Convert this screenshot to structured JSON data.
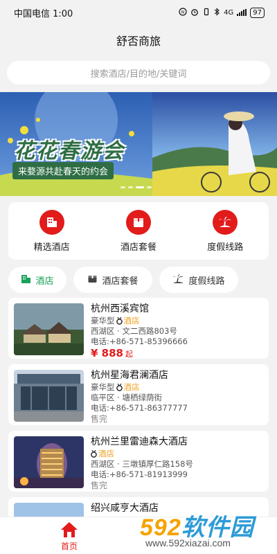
{
  "status": {
    "carrier_time": "中国电信 1:00",
    "battery": "97",
    "network": "4G"
  },
  "app": {
    "title": "舒否商旅"
  },
  "search": {
    "placeholder": "搜索酒店/目的地/关键词"
  },
  "banner": {
    "title": "花花春游会",
    "subtitle": "来婺源共赴春天的约会"
  },
  "categories": [
    {
      "label": "精选酒店",
      "icon": "hotel-building-icon"
    },
    {
      "label": "酒店套餐",
      "icon": "package-box-icon"
    },
    {
      "label": "度假线路",
      "icon": "palm-island-icon"
    }
  ],
  "tabs": [
    {
      "label": "酒店",
      "icon": "hotel-building-icon",
      "active": true
    },
    {
      "label": "酒店套餐",
      "icon": "package-box-icon",
      "active": false
    },
    {
      "label": "度假线路",
      "icon": "palm-island-icon",
      "active": false
    }
  ],
  "hotels": [
    {
      "name": "杭州西溪宾馆",
      "grade": "豪华型",
      "type": "酒店",
      "address": "西湖区 · 文二西路803号",
      "phone": "电话:+86-571-85396666",
      "price": "¥ 888",
      "price_suffix": "起"
    },
    {
      "name": "杭州星海君澜酒店",
      "grade": "豪华型",
      "type": "酒店",
      "address": "临平区 · 塘栖绿荫街",
      "phone": "电话:+86-571-86377777",
      "status": "售完"
    },
    {
      "name": "杭州兰里雷迪森大酒店",
      "grade": "",
      "type": "酒店",
      "address": "西湖区 · 三墩镇厚仁路158号",
      "phone": "电话:+86-571-81913999",
      "status": "售完"
    },
    {
      "name": "绍兴咸亨大酒店"
    }
  ],
  "bottom_nav": {
    "home_label": "首页"
  },
  "watermark": {
    "brand_num": "592",
    "brand_text": "软件园",
    "url": "www.592xiazai.com"
  },
  "colors": {
    "accent_red": "#e21b1b",
    "active_green": "#1aa15a",
    "hotel_orange": "#f0a020"
  }
}
